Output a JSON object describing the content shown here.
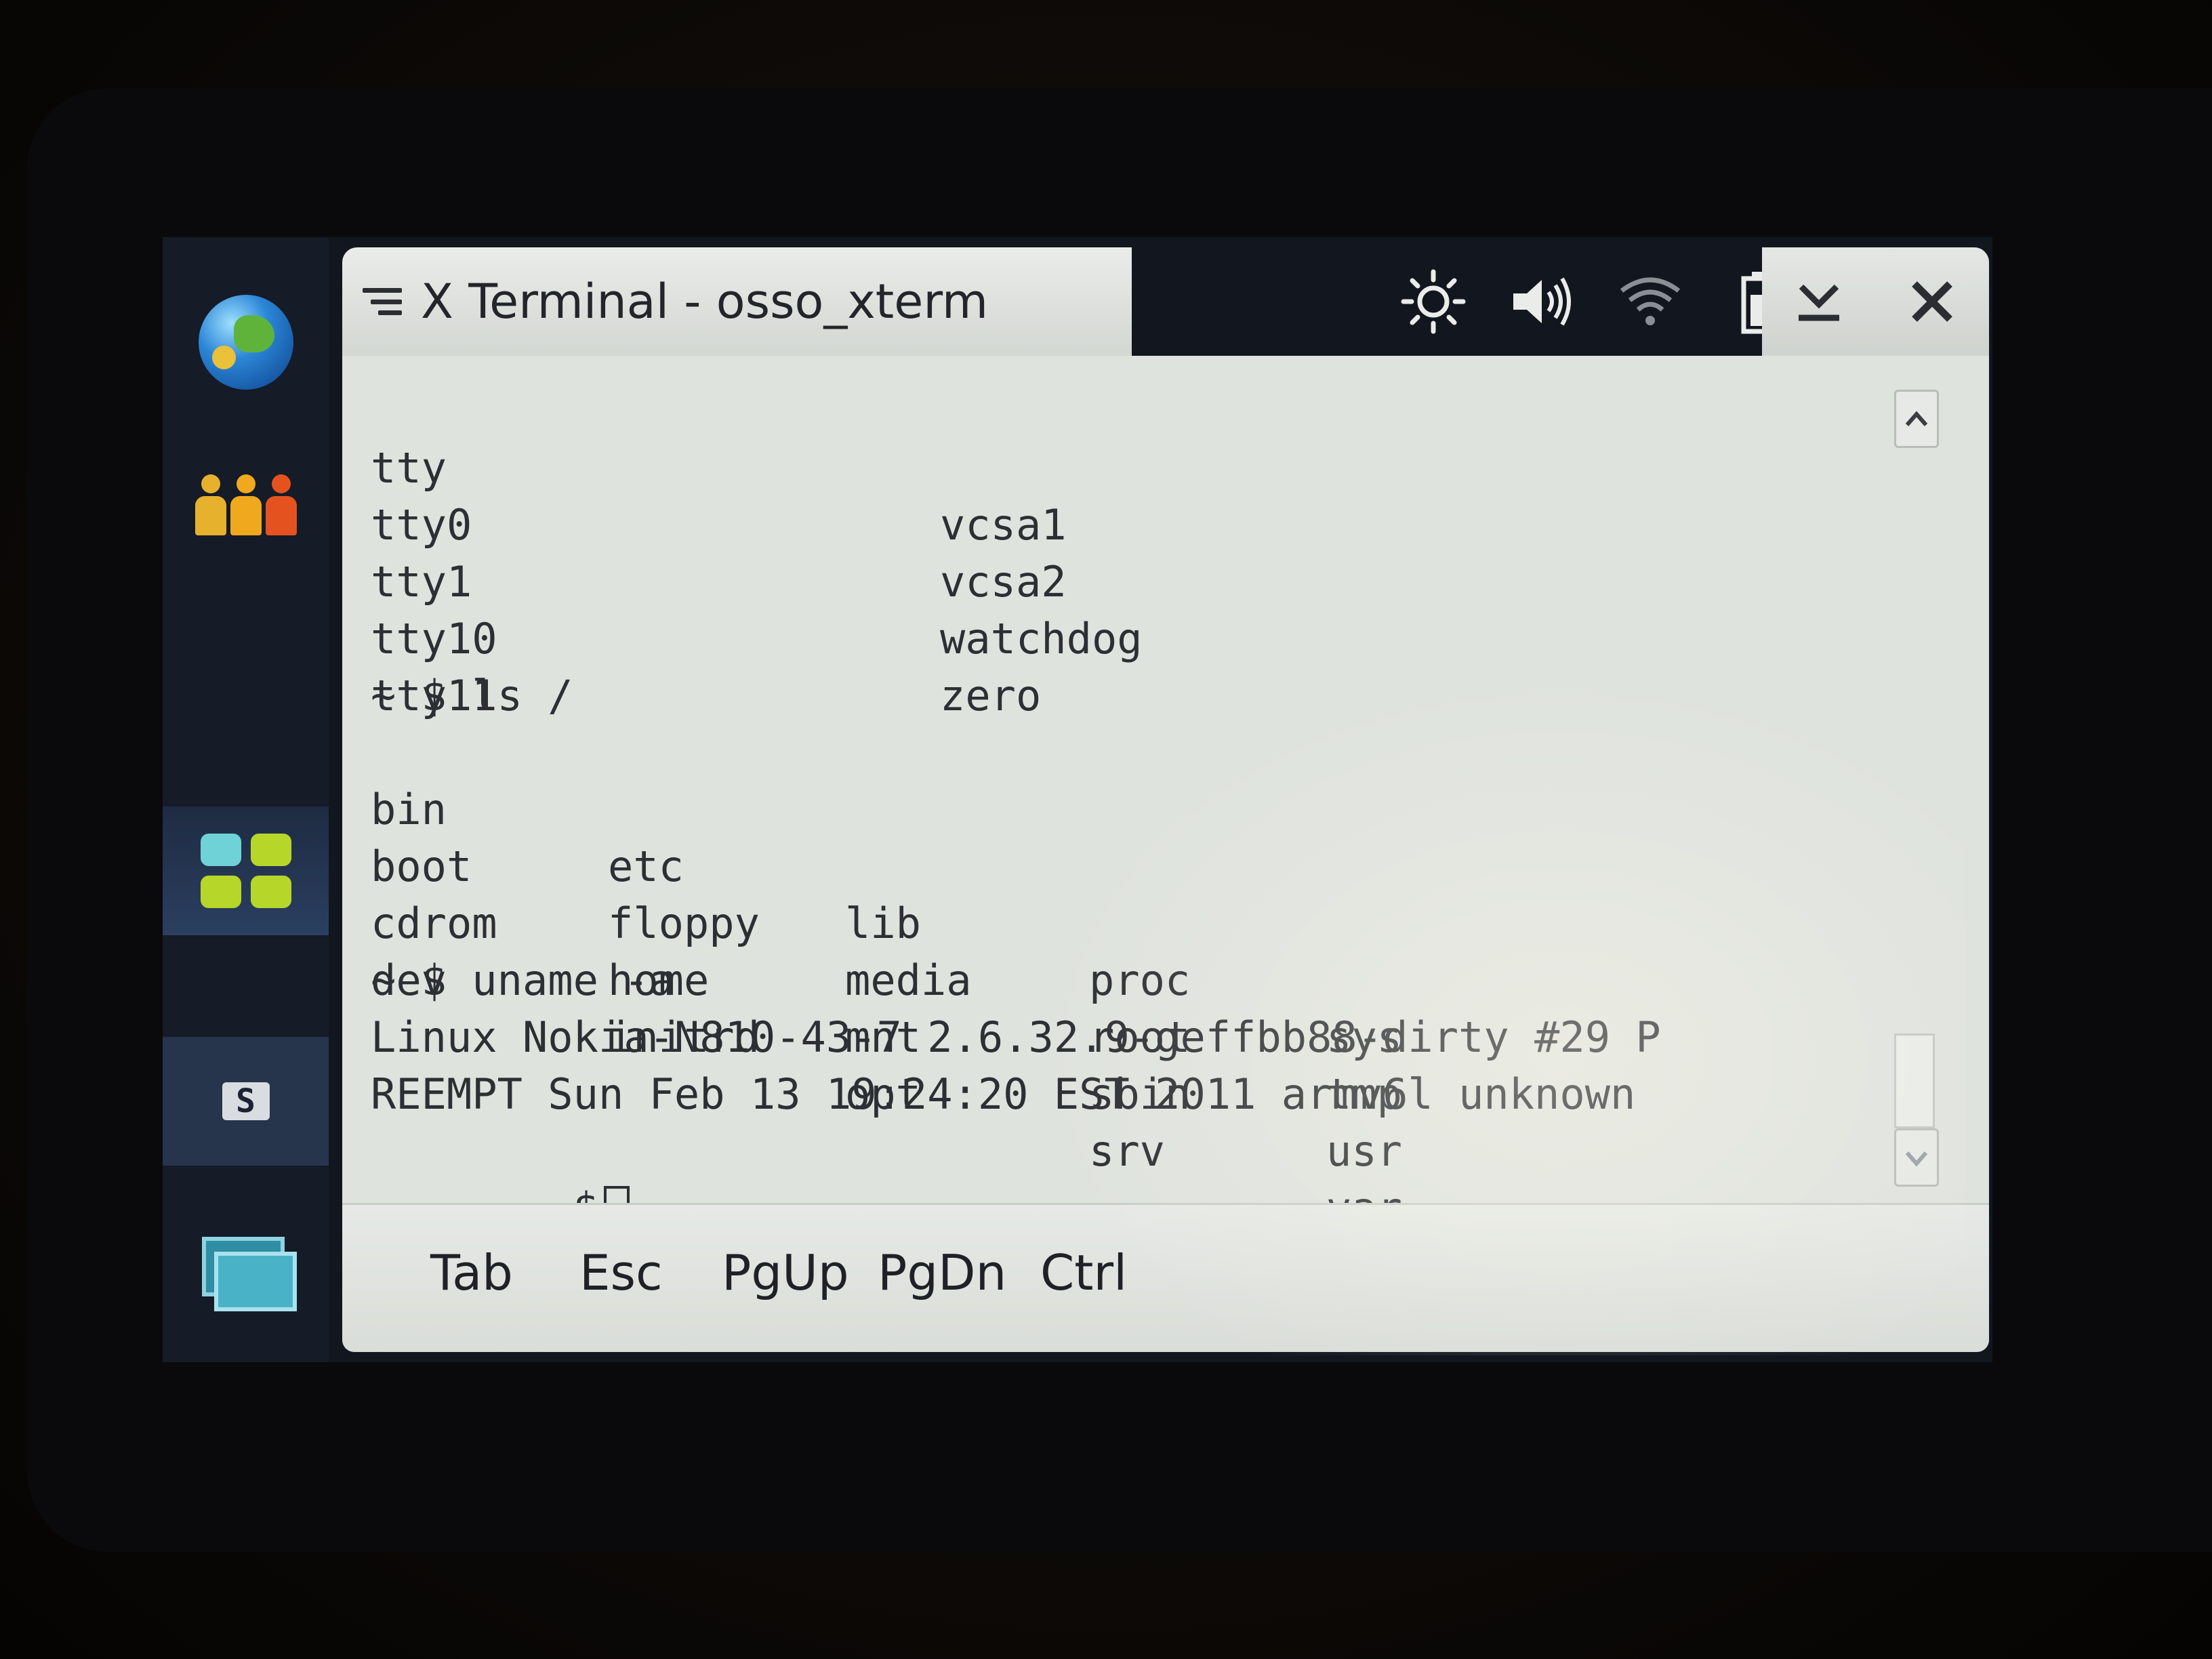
{
  "window": {
    "title": "X Terminal - osso_xterm"
  },
  "taskbar": {
    "items": [
      "web-browser",
      "contacts",
      "applications",
      "active-app",
      "task-switcher"
    ],
    "active_label": "S"
  },
  "terminal": {
    "lines_top": [
      {
        "left": "tty",
        "right": "vcsa1"
      },
      {
        "left": "tty0",
        "right": "vcsa2"
      },
      {
        "left": "tty1",
        "right": "watchdog"
      },
      {
        "left": "tty10",
        "right": "zero"
      },
      {
        "left": "tty11",
        "right": ""
      }
    ],
    "cmd_ls": "~ $ ls /",
    "ls_rows": [
      [
        "bin",
        "etc",
        "lib",
        "proc",
        "sys"
      ],
      [
        "boot",
        "floppy",
        "media",
        "root",
        "tmp"
      ],
      [
        "cdrom",
        "home",
        "mnt",
        "sbin",
        "usr"
      ],
      [
        "dev",
        "initrd",
        "opt",
        "srv",
        "var"
      ]
    ],
    "cmd_uname": "~ $ uname -a",
    "uname_line1": "Linux Nokia-N810-43-7 2.6.32.9-geffbb88-dirty #29 P",
    "uname_line2": "REEMPT Sun Feb 13 19:24:20 EST 2011 armv6l unknown",
    "prompt": "~ $"
  },
  "keybar": {
    "keys": [
      "Tab",
      "Esc",
      "PgUp",
      "PgDn",
      "Ctrl"
    ]
  },
  "status_icons": [
    "brightness-icon",
    "volume-icon",
    "wifi-icon",
    "battery-icon"
  ],
  "colors": {
    "terminal_bg": "#dfe3de",
    "terminal_fg": "#2c2f33",
    "titlebar_bg": "#12161e"
  }
}
